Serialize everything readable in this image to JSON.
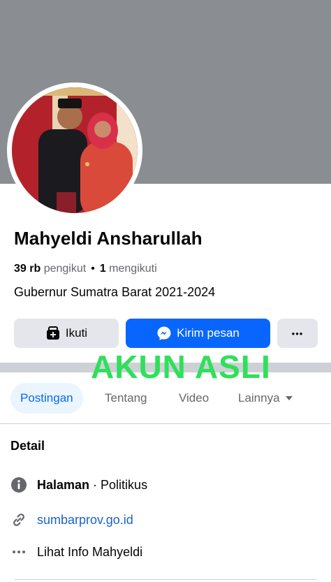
{
  "profile": {
    "name": "Mahyeldi Ansharullah",
    "followers_count": "39 rb",
    "followers_label": "pengikut",
    "following_count": "1",
    "following_label": "mengikuti",
    "bio": "Gubernur Sumatra Barat 2021-2024"
  },
  "actions": {
    "follow_label": "Ikuti",
    "message_label": "Kirim pesan",
    "more_label": "•••"
  },
  "overlay_text": "AKUN ASLI",
  "tabs": [
    {
      "label": "Postingan",
      "active": true
    },
    {
      "label": "Tentang",
      "active": false
    },
    {
      "label": "Video",
      "active": false
    },
    {
      "label": "Lainnya",
      "active": false
    }
  ],
  "detail": {
    "title": "Detail",
    "page_type_bold": "Halaman",
    "page_type_rest": " · Politikus",
    "website": "sumbarprov.go.id",
    "see_info": "Lihat Info Mahyeldi"
  },
  "colors": {
    "accent": "#0866ff",
    "cover": "#8a8d91",
    "button_gray": "#e4e6eb",
    "overlay_green": "#2ee05a",
    "link": "#1763cf"
  },
  "icons": {
    "follow": "person-add-icon",
    "message": "messenger-icon",
    "more": "more-dots-icon",
    "info": "info-icon",
    "link": "link-icon",
    "see_more": "ellipsis-icon",
    "tab_more": "caret-down-icon"
  }
}
